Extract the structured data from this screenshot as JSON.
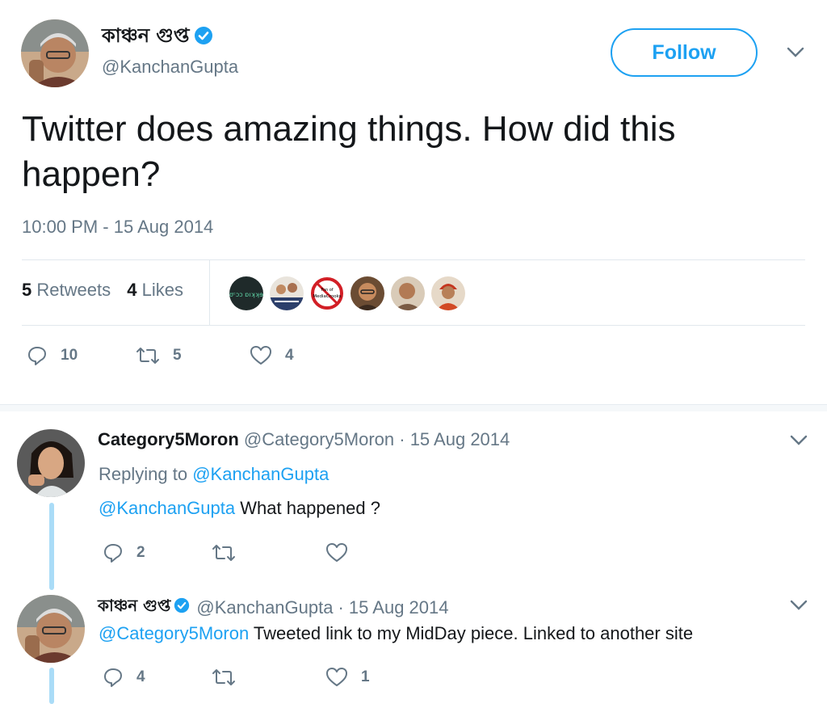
{
  "main_tweet": {
    "display_name": "কাঞ্চন গুপ্ত",
    "handle": "@KanchanGupta",
    "follow_label": "Follow",
    "text": "Twitter does amazing things. How did this happen?",
    "timestamp": "10:00 PM - 15 Aug 2014",
    "retweets_count": "5",
    "retweets_label": "Retweets",
    "likes_count": "4",
    "likes_label": "Likes",
    "liker_avatars": [
      "avatar-1",
      "avatar-2",
      "Fan of MediaCrooks",
      "avatar-4",
      "avatar-5",
      "avatar-6"
    ],
    "actions": {
      "replies": "10",
      "retweets": "5",
      "likes": "4"
    }
  },
  "replies": [
    {
      "display_name": "Category5Moron",
      "handle": "@Category5Moron",
      "date": "· 15 Aug 2014",
      "replying_prefix": "Replying to",
      "replying_to": "@KanchanGupta",
      "mention": "@KanchanGupta",
      "text": "What happened ?",
      "actions": {
        "replies": "2",
        "retweets": "",
        "likes": ""
      }
    },
    {
      "display_name": "কাঞ্চন গুপ্ত",
      "handle": "@KanchanGupta",
      "date": "· 15 Aug 2014",
      "mention": "@Category5Moron",
      "text": "Tweeted link to my MidDay piece. Linked to another site",
      "actions": {
        "replies": "4",
        "retweets": "",
        "likes": "1"
      }
    }
  ],
  "colors": {
    "accent": "#1da1f2",
    "text": "#14171a",
    "muted": "#657786",
    "thread": "#aadcf7"
  }
}
